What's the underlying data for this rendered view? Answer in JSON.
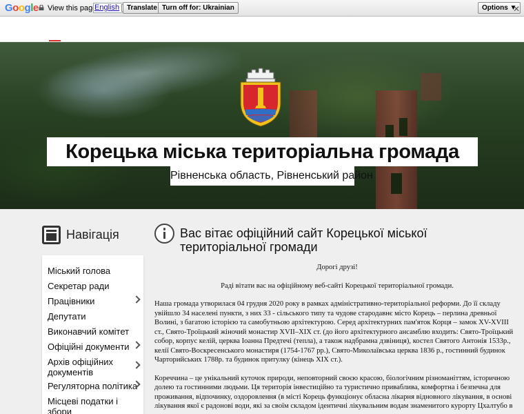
{
  "translate_bar": {
    "logo": [
      "G",
      "o",
      "o",
      "g",
      "l",
      "e"
    ],
    "view_text": "View this page in:",
    "language": "English",
    "translate_button": "Translate",
    "turn_off_button": "Turn off for: Ukrainian",
    "options_button": "Options ▼",
    "close_glyph": "✕"
  },
  "hero": {
    "title": "Корецька міська територіальна громада",
    "subtitle": "Рівненська область, Рівненський район"
  },
  "navigation": {
    "heading": "Навігація",
    "items": [
      {
        "label": "Міський голова",
        "has_submenu": false
      },
      {
        "label": "Секретар ради",
        "has_submenu": false
      },
      {
        "label": "Працівники",
        "has_submenu": true
      },
      {
        "label": "Депутати",
        "has_submenu": false
      },
      {
        "label": "Виконавчий комітет",
        "has_submenu": false
      },
      {
        "label": "Офіційні документи",
        "has_submenu": true
      },
      {
        "label": "Архів офіційних документів",
        "has_submenu": true
      },
      {
        "label": "Регуляторна політика",
        "has_submenu": true
      },
      {
        "label": "Місцеві податки і збори",
        "has_submenu": false
      }
    ]
  },
  "content": {
    "title": "Вас вітає офіційний сайт Корецької міської територіальної громади",
    "greeting": "Дорогі друзі!",
    "welcome": "Раді вітати вас на офіційному веб-сайті Корецької територіальної громади.",
    "paragraph1": "Наша громада утворилася 04 грудня 2020 року в рамках адміністративно-територіальної реформи. До її складу увійшло 34 населені пункти, з них 33 - сільського типу та чудове стародавнє місто Корець – перлина древньої Волині, з багатою історією та самобутньою архітектурою.  Серед архітектурних пам'яток Корця – замок XV-XVIII ст., Свято-Троїцький жіночий монастир XVII–XIX ст. (до його архітектурного ансамблю входить: Свято-Троїцький собор, корпус келій, церква Іоанна Предтечі (тепла), а також надбрамна дзвіниця), костел Святого Антонія 1533р., келії Свято-Воскресенського монастиря   (1754-1767 рр.),  Свято-Миколаївська церква 1836 р., гостинний будинок Чарторийських 1788р. та будинок притулку (кінець XIX ст.).",
    "paragraph2": "Кореччина – це унікальний куточок природи, неповторний своєю красою, біологічним різноманіттям, історичною долею та гостинними людьми. Ця територія  інвестиційно та туристично приваблива, комфортна і безпечна для проживання, відпочинку, оздоровлення (в місті Корець функціонує обласна лікарня відновного лікування, в основі лікування якої є радонові води, які за своїм складом ідентичні лікувальним водам знаменитого курорту Цхалтубо в"
  },
  "colors": {
    "accent": "#d9342b",
    "main_background": "#efefef",
    "crest_red": "#d8262e",
    "crest_blue": "#2f6fc4",
    "crest_gold": "#f2c21b"
  }
}
